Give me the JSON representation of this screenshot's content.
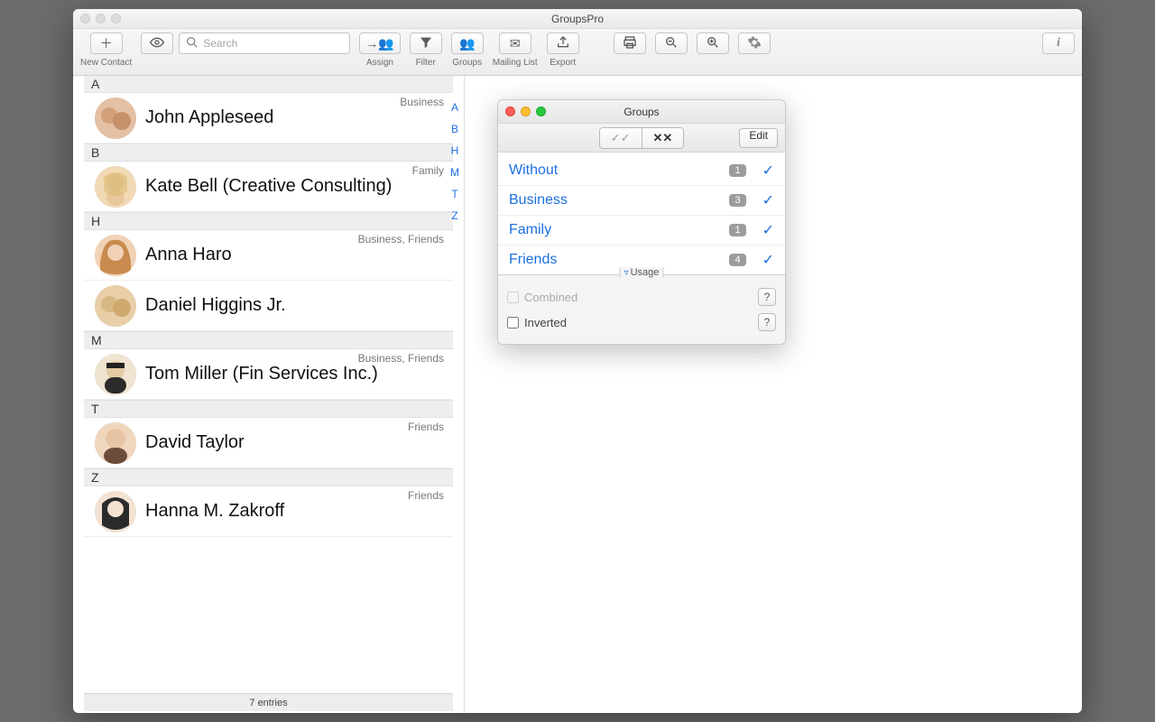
{
  "window": {
    "title": "GroupsPro"
  },
  "toolbar": {
    "new_contact_label": "New Contact",
    "search_placeholder": "Search",
    "assign_label": "Assign",
    "filter_label": "Filter",
    "groups_label": "Groups",
    "mailing_list_label": "Mailing List",
    "export_label": "Export"
  },
  "index_rail": {
    "a": "A",
    "b": "B",
    "h": "H",
    "m": "M",
    "t": "T",
    "z": "Z"
  },
  "sections": {
    "A": "A",
    "B": "B",
    "H": "H",
    "M": "M",
    "T": "T",
    "Z": "Z"
  },
  "contacts": {
    "john": {
      "name": "John Appleseed",
      "tags": "Business"
    },
    "kate": {
      "name": "Kate Bell (Creative Consulting)",
      "tags": "Family"
    },
    "anna": {
      "name": "Anna Haro",
      "tags": "Business, Friends"
    },
    "daniel": {
      "name": "Daniel Higgins Jr.",
      "tags": ""
    },
    "tom": {
      "name": "Tom Miller (Fin Services Inc.)",
      "tags": "Business, Friends"
    },
    "david": {
      "name": "David Taylor",
      "tags": "Friends"
    },
    "hanna": {
      "name": "Hanna M. Zakroff",
      "tags": "Friends"
    }
  },
  "footer": {
    "count_text": "7 entries"
  },
  "groups_panel": {
    "title": "Groups",
    "edit_label": "Edit",
    "rows": {
      "without": {
        "name": "Without",
        "count": "1"
      },
      "business": {
        "name": "Business",
        "count": "3"
      },
      "family": {
        "name": "Family",
        "count": "1"
      },
      "friends": {
        "name": "Friends",
        "count": "4"
      }
    },
    "usage_label": "Usage",
    "combined_label": "Combined",
    "inverted_label": "Inverted"
  }
}
